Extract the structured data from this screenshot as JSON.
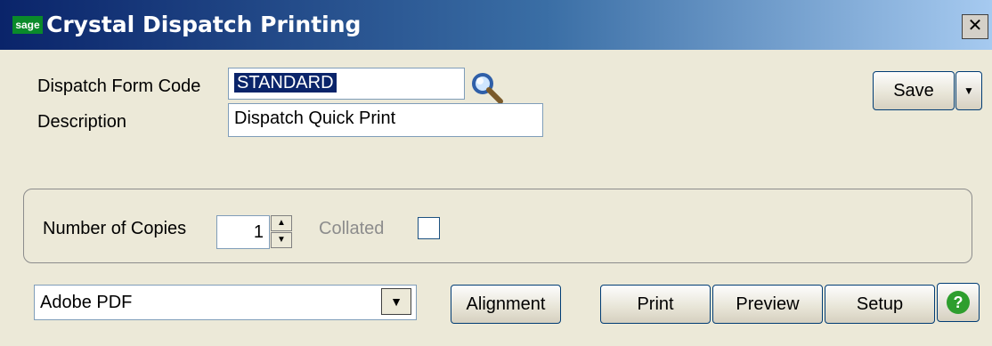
{
  "window": {
    "title": "Crystal Dispatch Printing",
    "logo_text": "sage",
    "close_glyph": "✕"
  },
  "form": {
    "dispatch_form_code_label": "Dispatch Form Code",
    "dispatch_form_code_value": "STANDARD",
    "description_label": "Description",
    "description_value": "Dispatch Quick Print",
    "lookup_icon": "magnifier-icon"
  },
  "copies": {
    "label": "Number of Copies",
    "value": "1",
    "collated_label": "Collated",
    "collated_checked": false
  },
  "printer": {
    "selected": "Adobe PDF"
  },
  "buttons": {
    "save": "Save",
    "alignment": "Alignment",
    "print": "Print",
    "preview": "Preview",
    "setup": "Setup",
    "help": "?"
  }
}
